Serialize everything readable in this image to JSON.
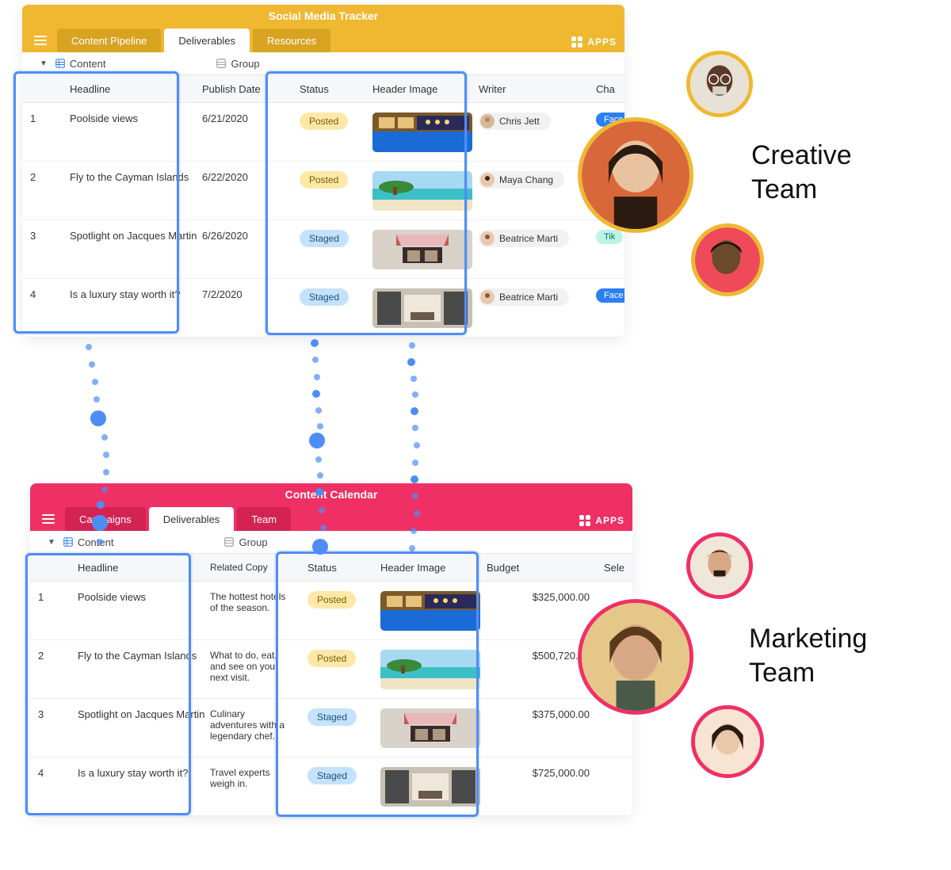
{
  "apps_label": "APPS",
  "top": {
    "title": "Social Media Tracker",
    "tabs": [
      "Content Pipeline",
      "Deliverables",
      "Resources"
    ],
    "active_tab": 1,
    "subnav": {
      "content": "Content",
      "group": "Group"
    },
    "columns": {
      "headline": "Headline",
      "publish_date": "Publish Date",
      "status": "Status",
      "header_image": "Header Image",
      "writer": "Writer",
      "cha": "Cha"
    },
    "rows": [
      {
        "n": "1",
        "headline": "Poolside views",
        "date": "6/21/2020",
        "status": "Posted",
        "writer": "Chris Jett",
        "ch": "Face",
        "img": "pool"
      },
      {
        "n": "2",
        "headline": "Fly to the Cayman Islands",
        "date": "6/22/2020",
        "status": "Posted",
        "writer": "Maya Chang",
        "ch": "",
        "img": "beach"
      },
      {
        "n": "3",
        "headline": "Spotlight on Jacques Martin",
        "date": "6/26/2020",
        "status": "Staged",
        "writer": "Beatrice Marti",
        "ch": "Tik",
        "img": "cafe"
      },
      {
        "n": "4",
        "headline": "Is a luxury stay worth it?",
        "date": "7/2/2020",
        "status": "Staged",
        "writer": "Beatrice Marti",
        "ch": "Face",
        "img": "lobby"
      }
    ]
  },
  "bottom": {
    "title": "Content Calendar",
    "tabs": [
      "Campaigns",
      "Deliverables",
      "Team"
    ],
    "active_tab": 1,
    "subnav": {
      "content": "Content",
      "group": "Group"
    },
    "columns": {
      "headline": "Headline",
      "related_copy": "Related Copy",
      "status": "Status",
      "header_image": "Header Image",
      "budget": "Budget",
      "sel": "Sele"
    },
    "rows": [
      {
        "n": "1",
        "headline": "Poolside views",
        "copy": "The hottest hotels of the season.",
        "status": "Posted",
        "budget": "$325,000.00",
        "img": "pool"
      },
      {
        "n": "2",
        "headline": "Fly to the Cayman Islands",
        "copy": "What to do, eat, and see on your next visit.",
        "status": "Posted",
        "budget": "$500,720.00",
        "img": "beach"
      },
      {
        "n": "3",
        "headline": "Spotlight on Jacques Martin",
        "copy": "Culinary adventures with a legendary chef.",
        "status": "Staged",
        "budget": "$375,000.00",
        "img": "cafe"
      },
      {
        "n": "4",
        "headline": "Is a luxury stay worth it?",
        "copy": "Travel experts weigh in.",
        "status": "Staged",
        "budget": "$725,000.00",
        "img": "lobby"
      }
    ]
  },
  "creative_team_label_1": "Creative",
  "creative_team_label_2": "Team",
  "marketing_team_label_1": "Marketing",
  "marketing_team_label_2": "Team"
}
